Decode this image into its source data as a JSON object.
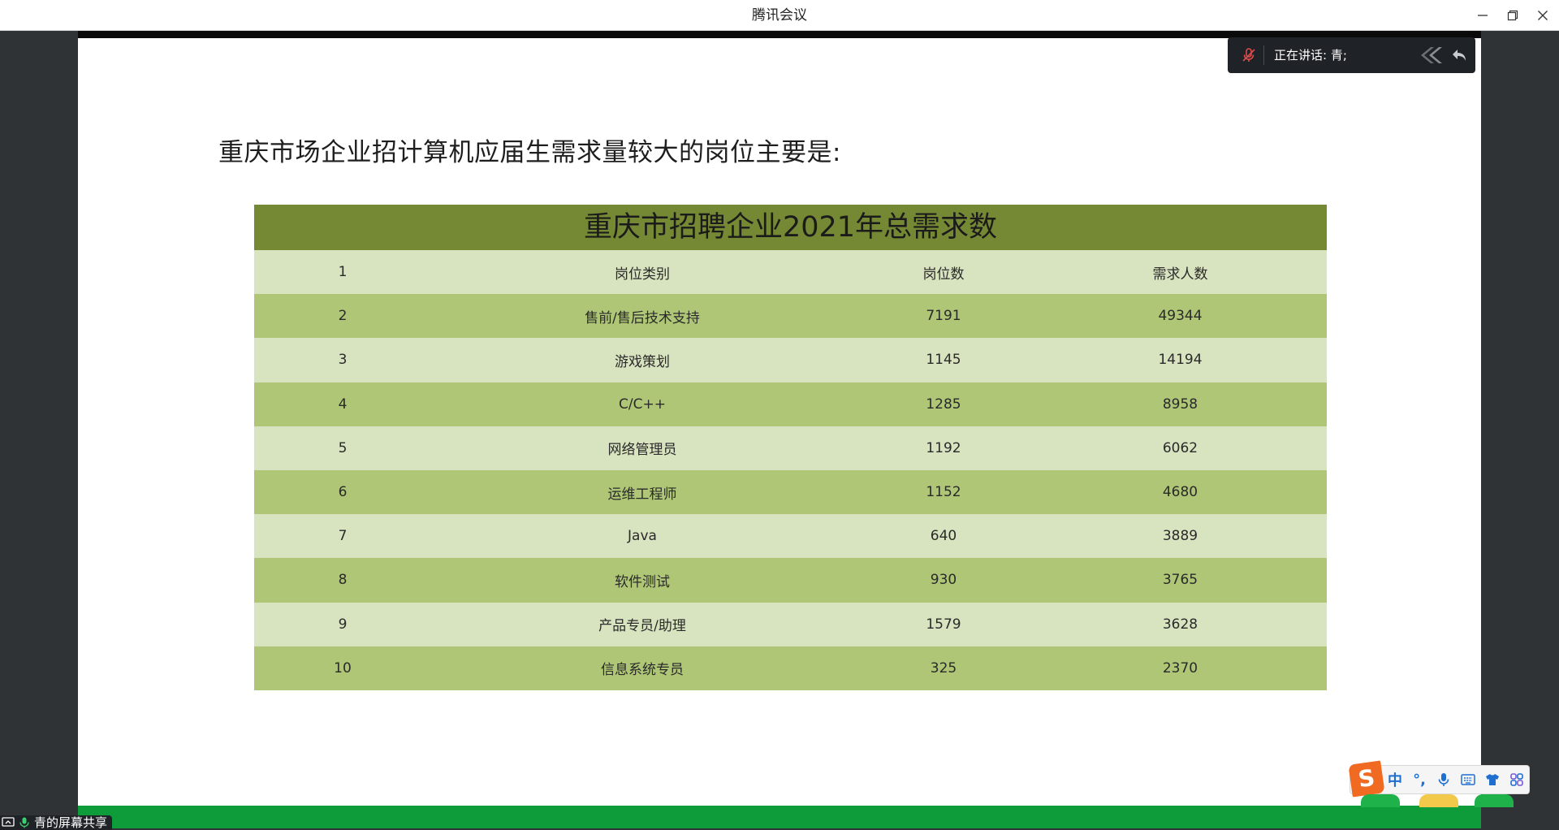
{
  "window": {
    "title": "腾讯会议"
  },
  "speaking": {
    "label": "正在讲话: 青;"
  },
  "slide": {
    "heading": "重庆市场企业招计算机应届生需求量较大的岗位主要是:",
    "table_title": "重庆市招聘企业2021年总需求数",
    "rows": [
      [
        "1",
        "岗位类别",
        "岗位数",
        "需求人数"
      ],
      [
        "2",
        "售前/售后技术支持",
        "7191",
        "49344"
      ],
      [
        "3",
        "游戏策划",
        "1145",
        "14194"
      ],
      [
        "4",
        "C/C++",
        "1285",
        "8958"
      ],
      [
        "5",
        "网络管理员",
        "1192",
        "6062"
      ],
      [
        "6",
        "运维工程师",
        "1152",
        "4680"
      ],
      [
        "7",
        "Java",
        "640",
        "3889"
      ],
      [
        "8",
        "软件测试",
        "930",
        "3765"
      ],
      [
        "9",
        "产品专员/助理",
        "1579",
        "3628"
      ],
      [
        "10",
        "信息系统专员",
        "325",
        "2370"
      ]
    ]
  },
  "ime": {
    "logo": "S",
    "mode": "中",
    "punct": "°,"
  },
  "share_label": "青的屏幕共享",
  "colors": {
    "table_title_bg": "#758834",
    "row_light": "#d8e3bf",
    "row_dark": "#aec675",
    "bottom_bar": "#0e9b3a"
  }
}
